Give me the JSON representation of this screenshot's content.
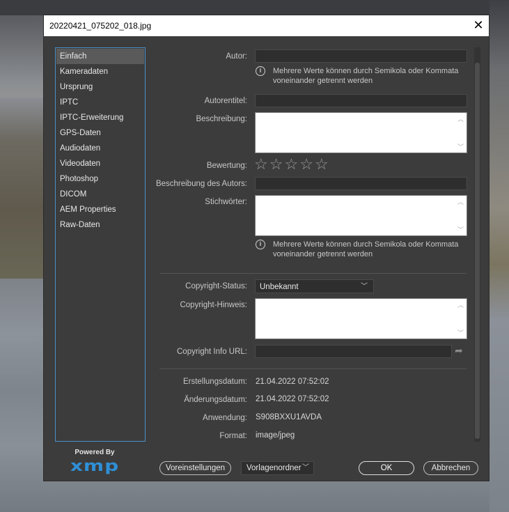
{
  "window": {
    "title": "20220421_075202_018.jpg",
    "close_glyph": "✕"
  },
  "sidebar": {
    "items": [
      {
        "label": "Einfach"
      },
      {
        "label": "Kameradaten"
      },
      {
        "label": "Ursprung"
      },
      {
        "label": "IPTC"
      },
      {
        "label": "IPTC-Erweiterung"
      },
      {
        "label": "GPS-Daten"
      },
      {
        "label": "Audiodaten"
      },
      {
        "label": "Videodaten"
      },
      {
        "label": "Photoshop"
      },
      {
        "label": "DICOM"
      },
      {
        "label": "AEM Properties"
      },
      {
        "label": "Raw-Daten"
      }
    ],
    "active_index": 0
  },
  "branding": {
    "powered_by": "Powered By",
    "logo_text": "xmp"
  },
  "form": {
    "autor_label": "Autor:",
    "autor_value": "",
    "autor_hint": "Mehrere Werte können durch Semikola oder Kommata voneinander getrennt werden",
    "autorentitel_label": "Autorentitel:",
    "autorentitel_value": "",
    "beschreibung_label": "Beschreibung:",
    "beschreibung_value": "",
    "bewertung_label": "Bewertung:",
    "rating": 0,
    "rating_max": 5,
    "beschreibung_autor_label": "Beschreibung des Autors:",
    "beschreibung_autor_value": "",
    "stichwoerter_label": "Stichwörter:",
    "stichwoerter_value": "",
    "stichwoerter_hint": "Mehrere Werte können durch Semikola oder Kommata voneinander getrennt werden",
    "copyright_status_label": "Copyright-Status:",
    "copyright_status_value": "Unbekannt",
    "copyright_hinweis_label": "Copyright-Hinweis:",
    "copyright_hinweis_value": "",
    "copyright_url_label": "Copyright Info URL:",
    "copyright_url_value": ""
  },
  "info": {
    "erstellungsdatum_label": "Erstellungsdatum:",
    "erstellungsdatum_value": "21.04.2022 07:52:02",
    "aenderungsdatum_label": "Änderungsdatum:",
    "aenderungsdatum_value": "21.04.2022 07:52:02",
    "anwendung_label": "Anwendung:",
    "anwendung_value": "S908BXXU1AVDA",
    "format_label": "Format:",
    "format_value": "image/jpeg"
  },
  "footer": {
    "voreinstellungen_label": "Voreinstellungen",
    "vorlagenordner_label": "Vorlagenordner",
    "ok_label": "OK",
    "abbrechen_label": "Abbrechen"
  },
  "colors": {
    "dialog_bg": "#3c3c3c",
    "sidebar_border": "#4a90c8",
    "xmp_logo": "#2f8fd6"
  }
}
